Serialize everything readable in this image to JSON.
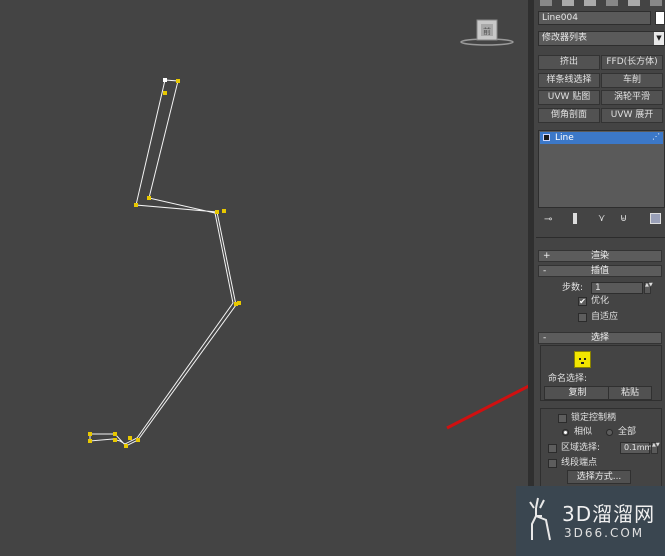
{
  "viewport": {
    "label": "viewport-perspective"
  },
  "panel": {
    "object_name": "Line004",
    "modifier_list": "修改器列表",
    "modifier_buttons": [
      "挤出",
      "FFD(长方体)",
      "样条线选择",
      "车削",
      "UVW 贴图",
      "涡轮平滑",
      "倒角剖面",
      "UVW 展开"
    ],
    "stack_item": "Line",
    "rollouts": {
      "render": "渲染",
      "interp": "插值",
      "select": "选择"
    },
    "steps_label": "步数:",
    "steps_value": "1",
    "optimize_label": "优化",
    "adaptive_label": "自适应",
    "named_selection_label": "命名选择:",
    "copy_label": "复制",
    "paste_label": "粘贴",
    "lock_handles_label": "锁定控制柄",
    "similar_label": "相似",
    "all_label": "全部",
    "area_select_label": "区域选择:",
    "area_select_value": "0.1mm",
    "segment_end_label": "线段端点",
    "select_by_label": "选择方式..."
  },
  "watermark": {
    "text": "3D溜溜网",
    "sub": "3D66.COM"
  },
  "colors": {
    "accent_selected": "#3c78c8",
    "vertex": "#e8c800",
    "annotation": "#d01010"
  }
}
